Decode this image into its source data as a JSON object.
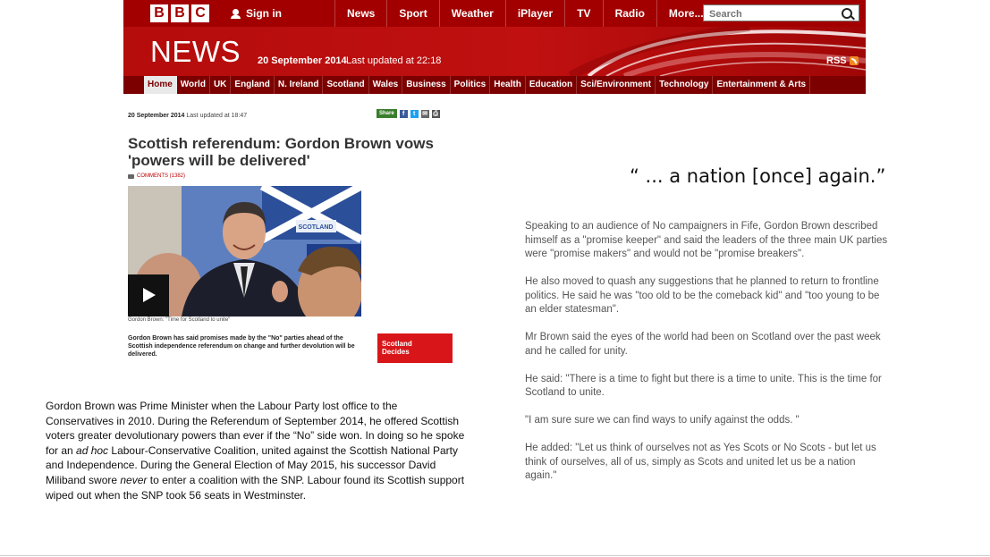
{
  "header": {
    "logo_letters": [
      "B",
      "B",
      "C"
    ],
    "sign_in": "Sign in",
    "nav": [
      "News",
      "Sport",
      "Weather",
      "iPlayer",
      "TV",
      "Radio",
      "More..."
    ],
    "search_placeholder": "Search",
    "section_title": "NEWS",
    "date": "20 September 2014",
    "last_updated": "Last updated at 22:18",
    "rss": "RSS",
    "subnav": [
      "Home",
      "World",
      "UK",
      "England",
      "N. Ireland",
      "Scotland",
      "Wales",
      "Business",
      "Politics",
      "Health",
      "Education",
      "Sci/Environment",
      "Technology",
      "Entertainment & Arts"
    ],
    "colors": {
      "top_bar": "#a20000",
      "banner": "#b50c0c",
      "subnav": "#7c0000"
    }
  },
  "article": {
    "date": "20 September 2014",
    "updated": "Last updated at 18:47",
    "share_label": "Share",
    "share_icons": [
      "facebook-icon",
      "twitter-icon",
      "email-icon",
      "print-icon"
    ],
    "headline": "Scottish referendum: Gordon Brown vows 'powers will be delivered'",
    "comments": "COMMENTS (1382)",
    "photo_caption": "Gordon Brown: \"Time for Scotland to unite\"",
    "summary": "Gordon Brown has said promises made by the \"No\" parties ahead of the Scottish independence referendum on change and further devolution will be delivered.",
    "promo_line1": "Scotland",
    "promo_line2": "Decides",
    "photo_sign": "SCOTLAND"
  },
  "commentary": {
    "p1": " Gordon Brown was Prime Minister when the Labour Party lost office to the Conservatives in 2010. During the Referendum of September 2014, he offered Scottish voters greater devolutionary powers than ever if the “No” side won. In doing so he spoke for an ",
    "em1": "ad hoc",
    "p2": "  Labour-Conservative Coalition, united against the Scottish National Party and Independence. During the General Election of May 2015, his successor David Miliband swore ",
    "em2": "never",
    "p3": " to enter a coalition with the SNP. Labour found its Scottish support wiped out when the SNP took 56 seats in Westminster."
  },
  "quote": "“ ... a nation [once] again.”",
  "speech": [
    "Speaking to an audience of No campaigners in Fife, Gordon Brown described himself as a \"promise keeper\" and said the leaders of the three main UK parties were \"promise makers\" and would not be \"promise breakers\".",
    "He also moved to quash any suggestions that he planned to return to frontline politics. He said he was \"too old to be the comeback kid\" and \"too young to be an elder statesman\".",
    "Mr Brown said the eyes of the world had been on Scotland over the past week and he called for unity.",
    "He said: \"There is a time to fight but there is a time to unite. This is the time for Scotland to unite.",
    "\"I am sure sure we can find ways to unify against the odds. \"",
    "He added: \"Let us think of ourselves not as Yes Scots or No Scots - but let us think of ourselves, all of us, simply as Scots and united let us be a nation again.\""
  ]
}
